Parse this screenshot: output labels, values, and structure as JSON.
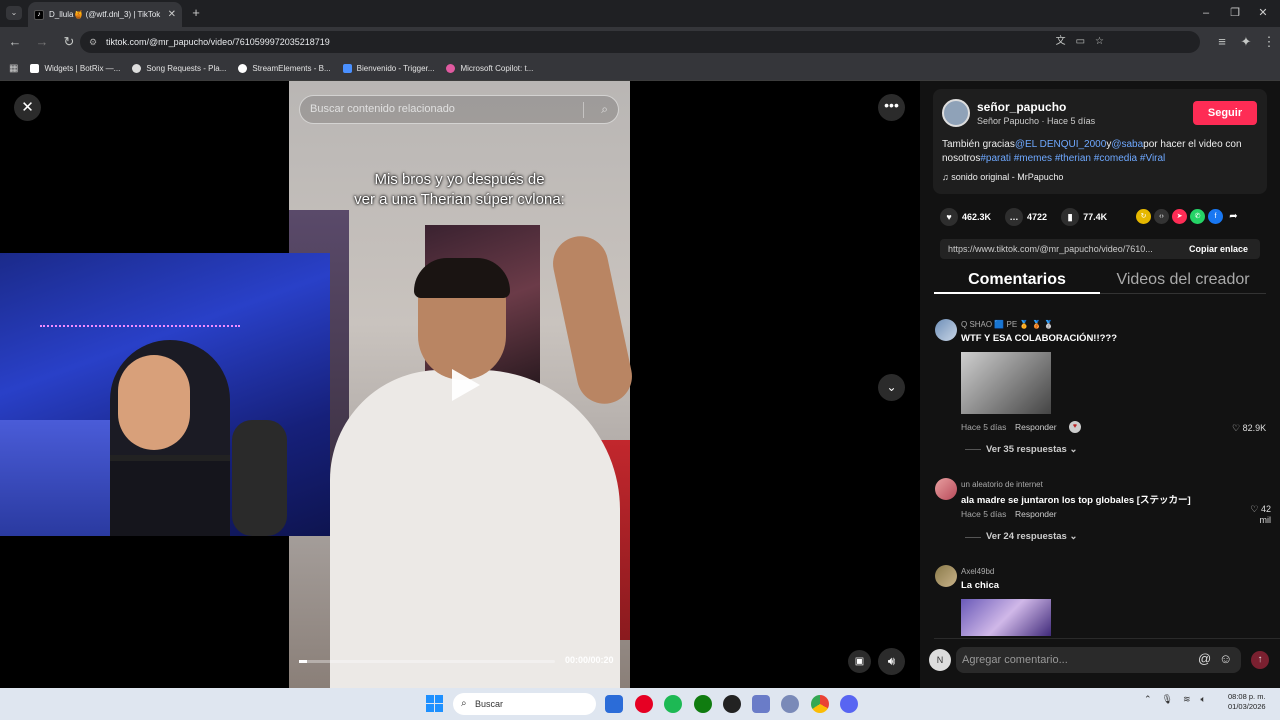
{
  "browser": {
    "tab_title": "D_llula🍯 (@wtf.dnl_3) | TikTok",
    "new_tab": "+",
    "url": "tiktok.com/@mr_papucho/video/7610599972035218719",
    "bookmarks": [
      {
        "label": "Widgets | BotRix —...",
        "color": "#ffffff"
      },
      {
        "label": "Song Requests - Pla...",
        "color": "#dddddd"
      },
      {
        "label": "StreamElements - B...",
        "color": "#ffffff"
      },
      {
        "label": "Bienvenido - Trigger...",
        "color": "#4a90ff"
      },
      {
        "label": "Microsoft Copilot: t...",
        "color": "#e05aa0"
      }
    ]
  },
  "video": {
    "search_placeholder": "Buscar contenido relacionado",
    "caption_line1": "Mis bros y yo después de",
    "caption_line2": "ver a una Therian súper cvlona:",
    "time": "00:00/00:20",
    "progress": 0.03
  },
  "post": {
    "username": "señor_papucho",
    "display": "Señor Papucho · Hace 5 días",
    "follow": "Seguir",
    "desc_pre": "También gracias",
    "mention1": "@EL DENQUI_2000",
    "desc_y": "y",
    "mention2": "@saba",
    "desc_mid": "por hacer el video con nosotros",
    "tags": "#parati #memes #therian #comedia #Viral",
    "sound": "sonido original - MrPapucho",
    "likes": "462.3K",
    "comments_count": "4722",
    "saves": "77.4K",
    "link": "https://www.tiktok.com/@mr_papucho/video/7610...",
    "copy_link": "Copiar enlace",
    "tab_comments": "Comentarios",
    "tab_creator": "Videos del creador"
  },
  "comments": [
    {
      "user": "Q SHAO 🟦 PE 🏅 🥉 🥈",
      "text": "WTF Y ESA COLABORACIÓN!!???",
      "time": "Hace 5 días",
      "reply": "Responder",
      "likes": "82.9K",
      "more": "Ver 35 respuestas"
    },
    {
      "user": "un aleatorio de internet",
      "text": "ala madre se juntaron los top globales [ステッカー]",
      "time": "Hace 5 días",
      "reply": "Responder",
      "likes": "42 mil",
      "more": "Ver 24 respuestas"
    },
    {
      "user": "Axel49bd",
      "text": "La chica"
    }
  ],
  "comment_input": {
    "placeholder": "Agregar comentario..."
  },
  "taskbar": {
    "search": "Buscar",
    "time": "08:08 p. m.",
    "date": "01/03/2026"
  }
}
